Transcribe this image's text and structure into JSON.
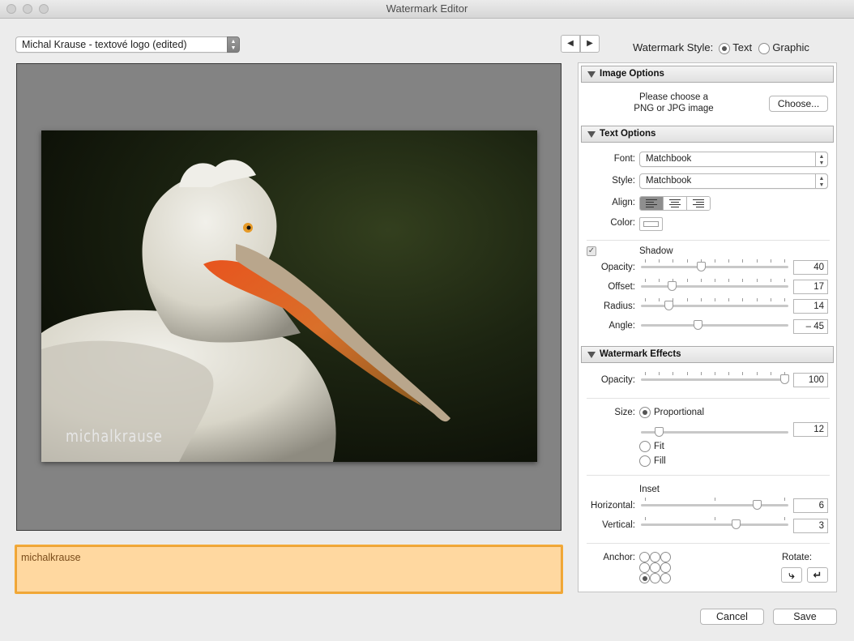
{
  "window": {
    "title": "Watermark Editor"
  },
  "preset": {
    "selected": "Michal Krause - textové logo (edited)"
  },
  "nav": {
    "prev_icon": "triangle-left-icon",
    "next_icon": "triangle-right-icon"
  },
  "style_selector": {
    "label": "Watermark Style:",
    "text_option": "Text",
    "graphic_option": "Graphic",
    "selected": "Text"
  },
  "preview": {
    "watermark_text": "michalkrause"
  },
  "text_entry": {
    "value": "michalkrause"
  },
  "image_options": {
    "header": "Image Options",
    "prompt_line1": "Please choose a",
    "prompt_line2": "PNG or JPG image",
    "choose_button": "Choose..."
  },
  "text_options": {
    "header": "Text Options",
    "font_label": "Font:",
    "font_value": "Matchbook",
    "style_label": "Style:",
    "style_value": "Matchbook",
    "align_label": "Align:",
    "align_selected": "left",
    "color_label": "Color:",
    "color_value": "#ffffff"
  },
  "shadow": {
    "label": "Shadow",
    "checked": true,
    "opacity": {
      "label": "Opacity:",
      "value": "40",
      "fraction": 0.4
    },
    "offset": {
      "label": "Offset:",
      "value": "17",
      "fraction": 0.19
    },
    "radius": {
      "label": "Radius:",
      "value": "14",
      "fraction": 0.17
    },
    "angle": {
      "label": "Angle:",
      "value": "– 45",
      "fraction": 0.38
    }
  },
  "effects": {
    "header": "Watermark Effects",
    "opacity": {
      "label": "Opacity:",
      "value": "100",
      "fraction": 1.0
    },
    "size_label": "Size:",
    "proportional_label": "Proportional",
    "size_value": "12",
    "size_fraction": 0.1,
    "fit_label": "Fit",
    "fill_label": "Fill",
    "size_mode": "proportional",
    "inset_label": "Inset",
    "horizontal": {
      "label": "Horizontal:",
      "value": "6",
      "fraction": 0.8
    },
    "vertical": {
      "label": "Vertical:",
      "value": "3",
      "fraction": 0.65
    },
    "anchor_label": "Anchor:",
    "anchor_selected": "bottom-left",
    "rotate_label": "Rotate:"
  },
  "footer": {
    "cancel_label": "Cancel",
    "save_label": "Save"
  }
}
